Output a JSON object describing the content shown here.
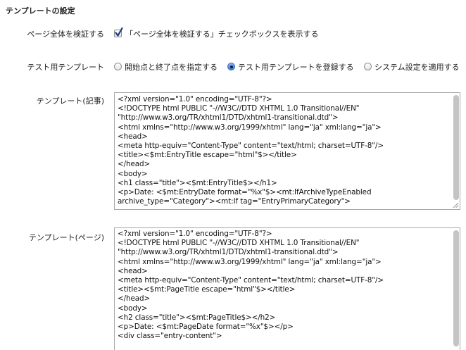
{
  "section_title": "テンプレートの設定",
  "verify_page": {
    "label": "ページ全体を検証する",
    "checkbox_checked": true,
    "checkbox_text": "「ページ全体を検証する」チェックボックスを表示する"
  },
  "test_template": {
    "label": "テスト用テンプレート",
    "options": [
      {
        "label": "開始点と終了点を指定する",
        "selected": false
      },
      {
        "label": "テスト用テンプレートを登録する",
        "selected": true
      },
      {
        "label": "システム設定を適用する",
        "selected": false
      }
    ]
  },
  "template_entry": {
    "label": "テンプレート(記事)",
    "lines": [
      "<?xml version=\"1.0\" encoding=\"UTF-8\"?>",
      "<!DOCTYPE html PUBLIC \"-//W3C//DTD XHTML 1.0 Transitional//EN\"",
      "\"http://www.w3.org/TR/xhtml1/DTD/xhtml1-transitional.dtd\">",
      "<html xmlns=\"http://www.w3.org/1999/xhtml\" lang=\"ja\" xml:lang=\"ja\">",
      "<head>",
      "<meta http-equiv=\"Content-Type\" content=\"text/html; charset=UTF-8\"/>",
      "<title><$mt:EntryTitle escape=\"html\"$></title>",
      "</head>",
      "<body>",
      "<h1 class=\"title\"><$mt:EntryTitle$></h1>",
      "<p>Date: <$mt:EntryDate format=\"%x\"$><mt:IfArchiveTypeEnabled",
      "archive_type=\"Category\"><mt:If tag=\"EntryPrimaryCategory\">"
    ]
  },
  "template_page": {
    "label": "テンプレート(ページ)",
    "lines": [
      "<?xml version=\"1.0\" encoding=\"UTF-8\"?>",
      "<!DOCTYPE html PUBLIC \"-//W3C//DTD XHTML 1.0 Transitional//EN\"",
      "\"http://www.w3.org/TR/xhtml1/DTD/xhtml1-transitional.dtd\">",
      "<html xmlns=\"http://www.w3.org/1999/xhtml\" lang=\"ja\" xml:lang=\"ja\">",
      "<head>",
      "<meta http-equiv=\"Content-Type\" content=\"text/html; charset=UTF-8\"/>",
      "<title><$mt:PageTitle escape=\"html\"$></title>",
      "</head>",
      "<body>",
      "<h2 class=\"title\"><$mt:PageTitle$></h2>",
      "<p>Date: <$mt:PageDate format=\"%x\"$></p>",
      "<div class=\"entry-content\">"
    ]
  }
}
